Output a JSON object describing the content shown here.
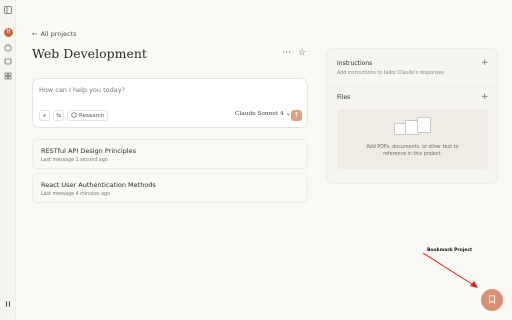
{
  "rail": {
    "avatar_initial": "H",
    "icons": [
      "sidebar-toggle-icon",
      "new-chat-icon",
      "chats-icon",
      "projects-icon",
      "collapse-icon"
    ]
  },
  "header": {
    "back_link": "All projects",
    "back_arrow": "←",
    "title": "Web Development",
    "more_icon": "⋯",
    "star_icon": "☆"
  },
  "composer": {
    "placeholder": "How can I help you today?",
    "plus_icon": "+",
    "settings_icon": "⇆",
    "research_label": "Research",
    "model_label": "Claude Sonnet 4",
    "model_chevron": "⌄",
    "send_icon": "↑"
  },
  "chats": [
    {
      "title": "RESTful API Design Principles",
      "meta": "Last message 1 second ago"
    },
    {
      "title": "React User Authentication Methods",
      "meta": "Last message 4 minutes ago"
    }
  ],
  "panel": {
    "instructions_title": "Instructions",
    "instructions_sub": "Add instructions to tailor Claude's responses",
    "files_title": "Files",
    "plus_icon": "+",
    "dropzone_line1": "Add PDFs, documents, or other text to",
    "dropzone_line2": "reference in this project."
  },
  "annotation": {
    "label": "Bookmark Project",
    "arrow_color": "#e02020"
  },
  "bookmark_button": {
    "icon": "🔖",
    "color": "#d98f73"
  },
  "colors": {
    "accent": "#c96442",
    "send": "#e0a07f",
    "background": "#faf9f5"
  }
}
